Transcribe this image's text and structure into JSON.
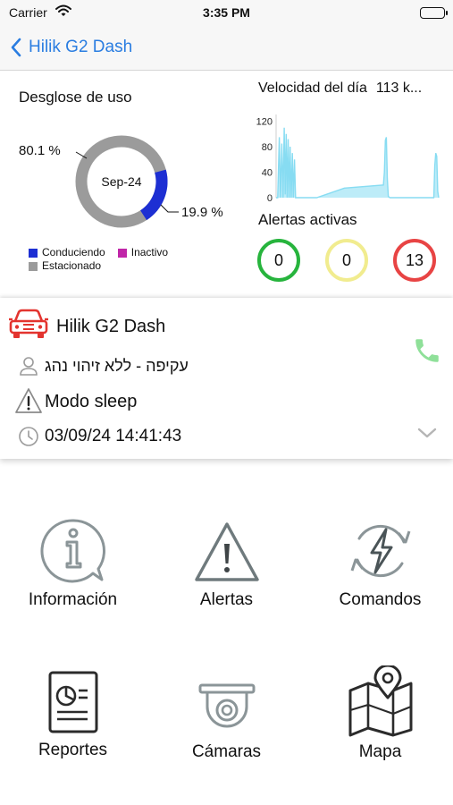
{
  "status_bar": {
    "carrier": "Carrier",
    "time": "3:35 PM"
  },
  "nav": {
    "back_label": "Hilik G2 Dash"
  },
  "usage": {
    "title": "Desglose de uso",
    "center_label": "Sep-24",
    "driving_pct_label": "19.9 %",
    "parked_pct_label": "80.1 %",
    "legend": [
      {
        "label": "Conduciendo",
        "color": "#1d2fd3"
      },
      {
        "label": "Inactivo",
        "color": "#c026a8"
      },
      {
        "label": "Estacionado",
        "color": "#9b9b9b"
      }
    ]
  },
  "speed": {
    "title": "Velocidad del día",
    "value": "113 k..."
  },
  "alerts": {
    "title": "Alertas activas",
    "items": [
      {
        "count": "0",
        "color": "#27b43d"
      },
      {
        "count": "0",
        "color": "#f1ec8f"
      },
      {
        "count": "13",
        "color": "#e84444"
      }
    ]
  },
  "vehicle": {
    "name": "Hilik G2 Dash",
    "driver": "עקיפה - ללא זיהוי נהג",
    "mode": "Modo sleep",
    "timestamp": "03/09/24 14:41:43"
  },
  "menu": {
    "items": [
      {
        "label": "Información",
        "icon": "info-bubble-icon"
      },
      {
        "label": "Alertas",
        "icon": "warning-triangle-icon"
      },
      {
        "label": "Comandos",
        "icon": "lightning-refresh-icon"
      },
      {
        "label": "Reportes",
        "icon": "report-document-icon"
      },
      {
        "label": "Cámaras",
        "icon": "dome-camera-icon"
      },
      {
        "label": "Mapa",
        "icon": "map-pin-icon"
      }
    ]
  },
  "chart_data": {
    "type": "line",
    "title": "Velocidad del día",
    "yticks": [
      0,
      40,
      80,
      120
    ],
    "ylim": [
      0,
      125
    ],
    "xlim": [
      0,
      100
    ],
    "color": "#87dcf2",
    "series": [
      {
        "values": [
          [
            0,
            0
          ],
          [
            1,
            0
          ],
          [
            2,
            95
          ],
          [
            2.7,
            0
          ],
          [
            3.5,
            85
          ],
          [
            4.3,
            0
          ],
          [
            5,
            110
          ],
          [
            5.6,
            5
          ],
          [
            6.2,
            100
          ],
          [
            6.8,
            0
          ],
          [
            7.4,
            92
          ],
          [
            8,
            0
          ],
          [
            8.6,
            80
          ],
          [
            9.3,
            0
          ],
          [
            10,
            70
          ],
          [
            10.6,
            0
          ],
          [
            11.3,
            60
          ],
          [
            12,
            0
          ],
          [
            12,
            0
          ],
          [
            25,
            0
          ],
          [
            42,
            15
          ],
          [
            66,
            20
          ],
          [
            66.6,
            40
          ],
          [
            67.2,
            90
          ],
          [
            67.8,
            95
          ],
          [
            68.4,
            30
          ],
          [
            69,
            2
          ],
          [
            70,
            0
          ],
          [
            97,
            0
          ],
          [
            97.6,
            50
          ],
          [
            98.2,
            70
          ],
          [
            98.8,
            65
          ],
          [
            99.4,
            10
          ],
          [
            100,
            0
          ]
        ]
      }
    ]
  }
}
